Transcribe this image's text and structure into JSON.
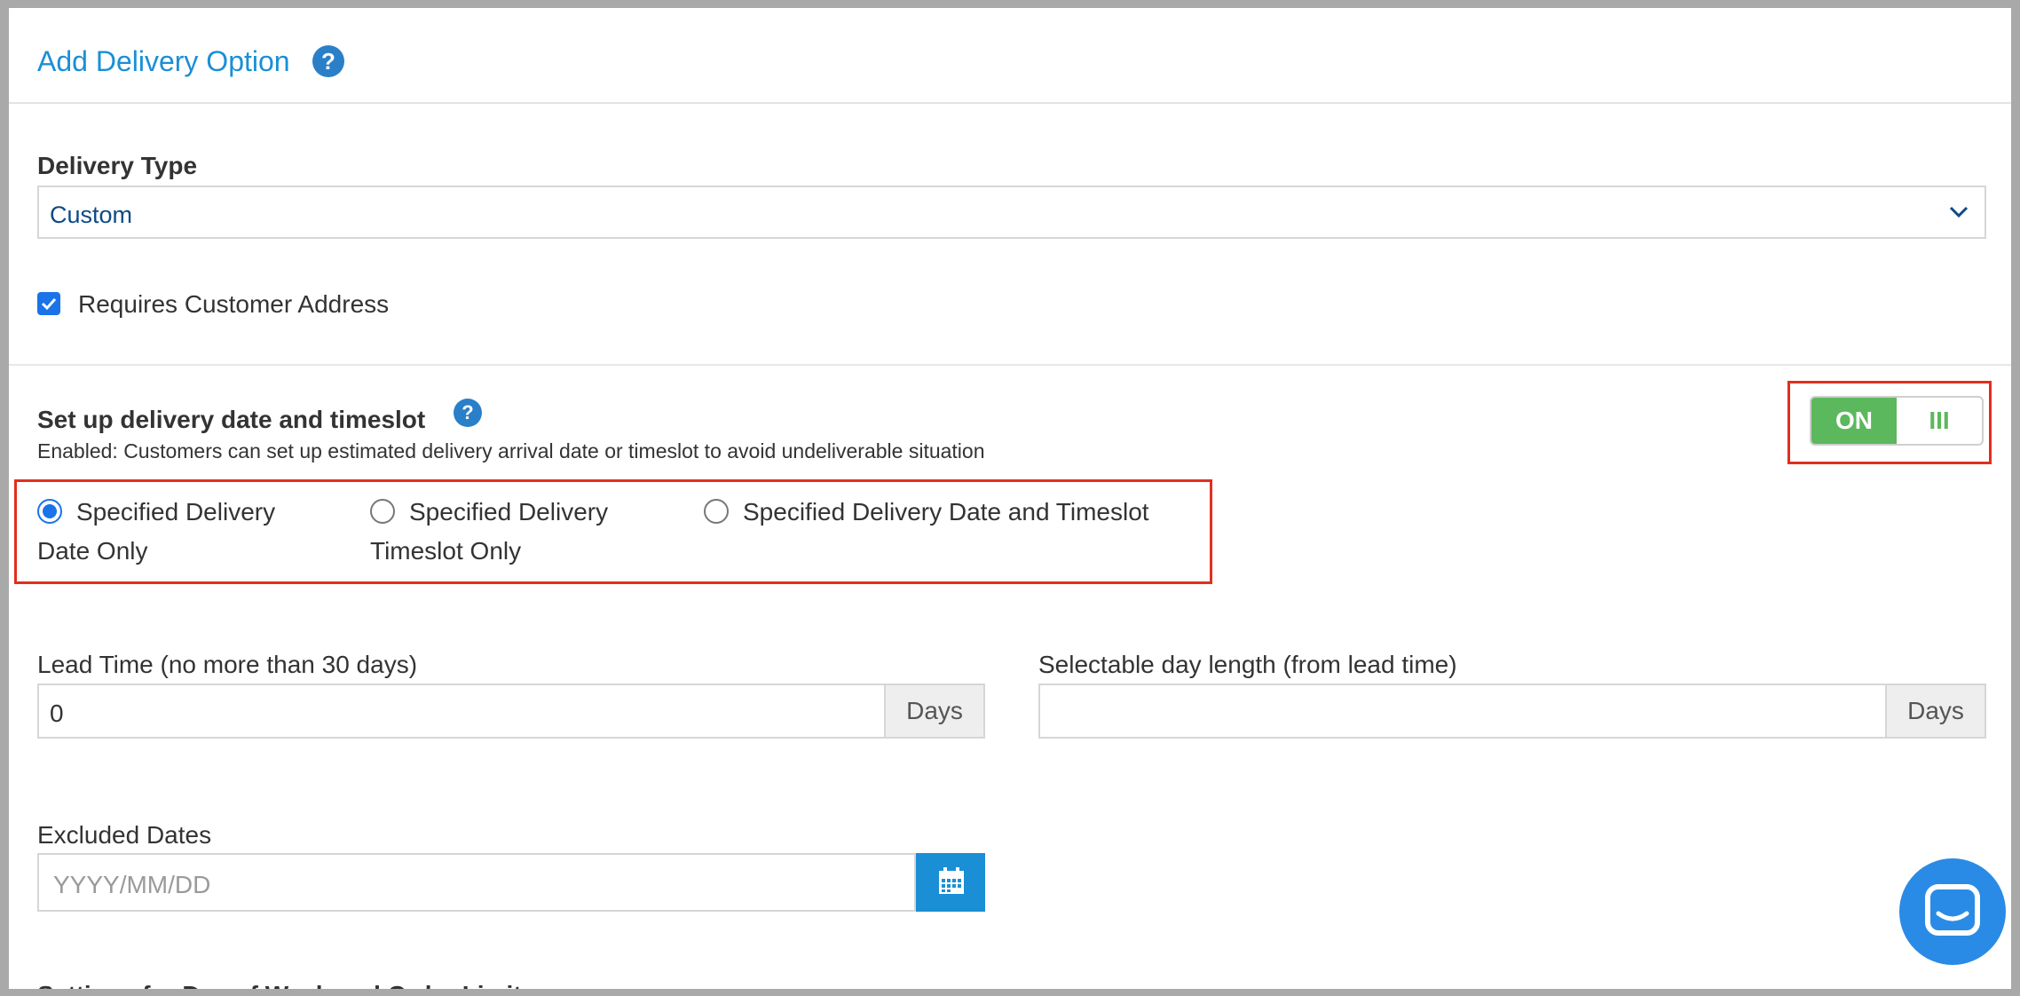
{
  "header": {
    "title": "Add Delivery Option"
  },
  "delivery_type": {
    "label": "Delivery Type",
    "selected": "Custom"
  },
  "requires_address": {
    "label": "Requires Customer Address",
    "checked": true
  },
  "timeslot_section": {
    "title": "Set up delivery date and timeslot",
    "description": "Enabled: Customers can set up estimated delivery arrival date or timeslot to avoid undeliverable situation",
    "toggle": {
      "on_label": "ON",
      "handle_label": "III",
      "state": "on"
    },
    "options": [
      {
        "line1": "Specified Delivery",
        "line2": "Date Only",
        "checked": true
      },
      {
        "line1": "Specified Delivery",
        "line2": "Timeslot Only",
        "checked": false
      },
      {
        "line1": "Specified Delivery Date and Timeslot",
        "line2": "",
        "checked": false
      }
    ]
  },
  "lead_time": {
    "label": "Lead Time (no more than 30 days)",
    "value": "0",
    "unit": "Days"
  },
  "selectable_length": {
    "label": "Selectable day length (from lead time)",
    "value": "",
    "unit": "Days"
  },
  "excluded_dates": {
    "label": "Excluded Dates",
    "placeholder": "YYYY/MM/DD"
  },
  "next_section": {
    "title": "Settings for Day of Week and Order Limit"
  },
  "colors": {
    "accent": "#1a8fd6",
    "toggle_on": "#5cb85c",
    "highlight": "#e0301e"
  }
}
